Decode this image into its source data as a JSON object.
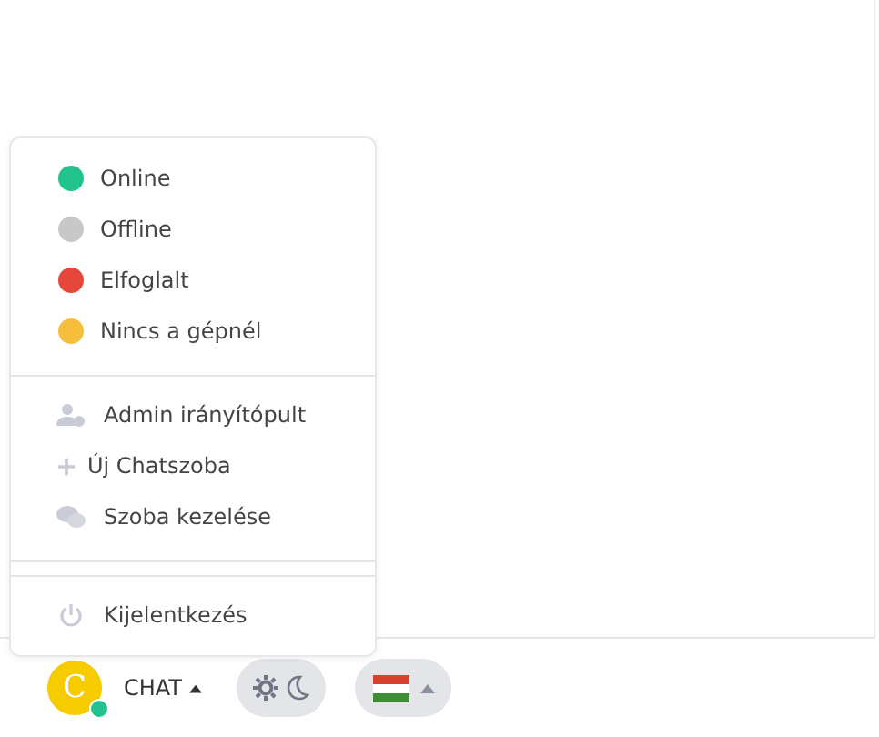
{
  "menu": {
    "statuses": [
      {
        "label": "Online",
        "color": "#22c38e"
      },
      {
        "label": "Offline",
        "color": "#c8c8c8"
      },
      {
        "label": "Elfoglalt",
        "color": "#e5483b"
      },
      {
        "label": "Nincs a gépnél",
        "color": "#f5be3c"
      }
    ],
    "actions": [
      {
        "label": "Admin irányítópult"
      },
      {
        "label": "Új Chatszoba"
      },
      {
        "label": "Szoba kezelése"
      }
    ],
    "logout": {
      "label": "Kijelentkezés"
    }
  },
  "footer": {
    "avatar": {
      "initial": "C",
      "online": true
    },
    "user_label": "CHAT",
    "theme": {
      "dark": false
    }
  }
}
